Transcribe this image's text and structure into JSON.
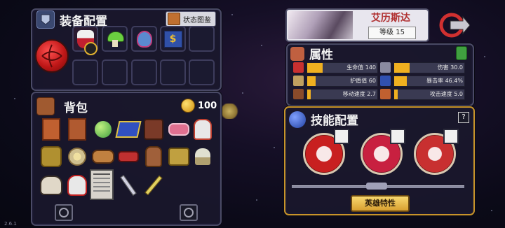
{
  "equipment": {
    "title": "装备配置",
    "status_button": "状态图鉴",
    "items": [
      "red-ball-weapon-icon",
      "demon-mask-icon",
      "green-mushroom-icon",
      "blue-spirit-icon",
      "gold-coin-card-icon"
    ]
  },
  "backpack": {
    "title": "背包",
    "gold": "100"
  },
  "hero": {
    "name": "艾历斯达",
    "level": "等级 15"
  },
  "attributes": {
    "title": "属性",
    "stats": [
      {
        "label": "生命值 140",
        "icon": "heart-icon",
        "color": "#c83030",
        "fill": 0.22
      },
      {
        "label": "伤害 30.0",
        "icon": "sword-icon",
        "color": "#8a8aa0",
        "fill": 0.22
      },
      {
        "label": "护盾值 60",
        "icon": "shield-icon",
        "color": "#c0a060",
        "fill": 0.12
      },
      {
        "label": "暴击率 46.4%",
        "icon": "eye-icon",
        "color": "#3050b0",
        "fill": 0.18
      },
      {
        "label": "移动速度 2.7",
        "icon": "boot-icon",
        "color": "#8a4a2a",
        "fill": 0.05
      },
      {
        "label": "攻击速度 5.0",
        "icon": "ore-icon",
        "color": "#c06030",
        "fill": 0.05
      }
    ]
  },
  "skills": {
    "title": "技能配置",
    "help": "?",
    "trait_button": "英雄特性"
  },
  "version": "2.6.1"
}
